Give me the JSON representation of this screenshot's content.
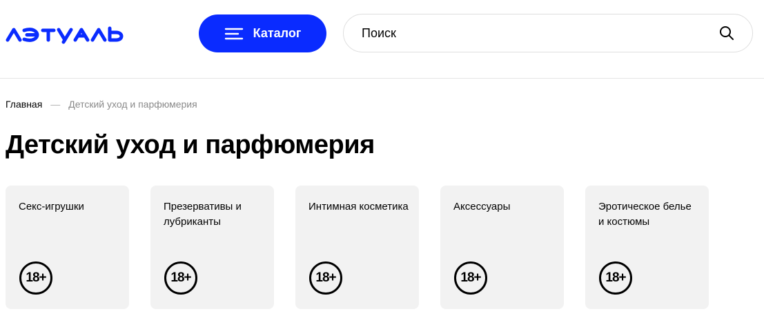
{
  "header": {
    "logo_text": "лэтуаль",
    "catalog_label": "Каталог",
    "search_placeholder": "Поиск"
  },
  "breadcrumb": {
    "home": "Главная",
    "separator": "—",
    "current": "Детский уход и парфюмерия"
  },
  "page_title": "Детский уход и парфюмерия",
  "categories": [
    {
      "label": "Секс-игрушки",
      "badge": "18+"
    },
    {
      "label": "Презервативы и лубриканты",
      "badge": "18+"
    },
    {
      "label": "Интимная косметика",
      "badge": "18+"
    },
    {
      "label": "Аксессуары",
      "badge": "18+"
    },
    {
      "label": "Эротическое белье и костюмы",
      "badge": "18+"
    }
  ],
  "colors": {
    "brand_blue": "#0a2bff",
    "card_bg": "#f2f2f2",
    "muted_text": "#8a8a8a"
  },
  "icons": [
    "menu-icon",
    "search-icon"
  ]
}
